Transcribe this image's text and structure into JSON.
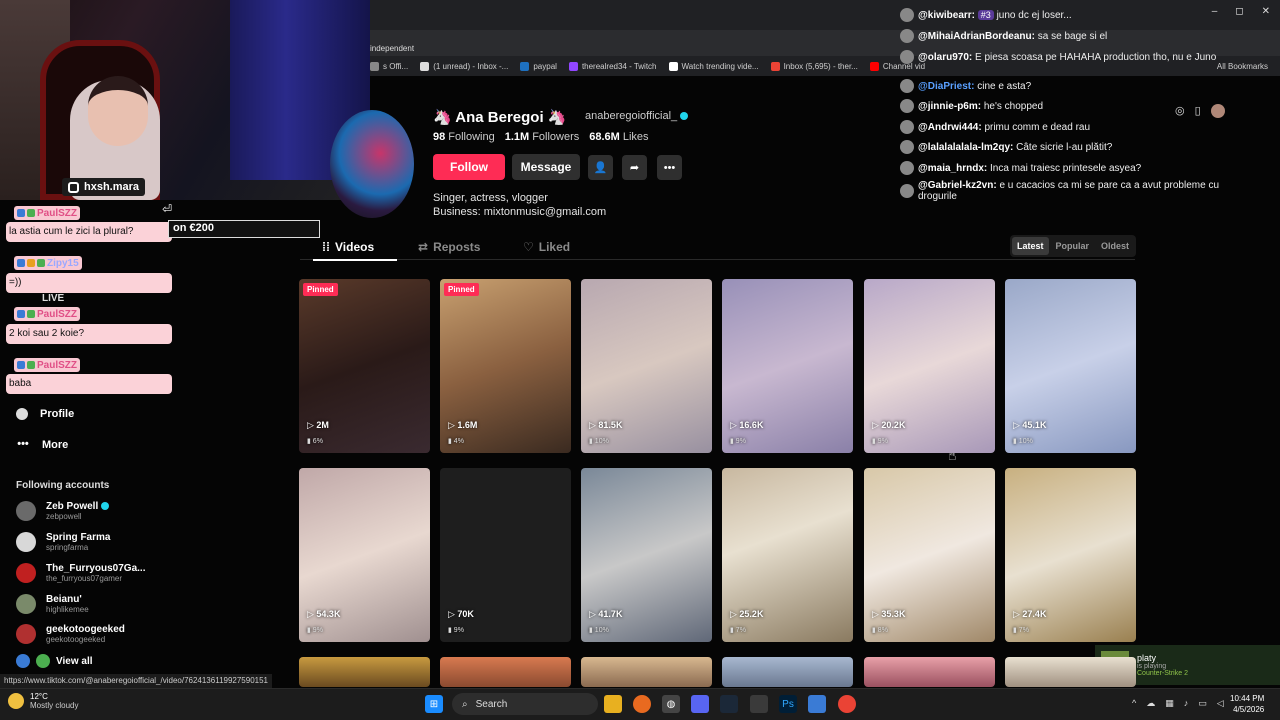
{
  "window": {
    "min": "–",
    "max": "◻",
    "close": "✕"
  },
  "bookmarks": [
    {
      "label": "s Offi...",
      "color": "#888"
    },
    {
      "label": "(1 unread) - Inbox -...",
      "color": "#ddd"
    },
    {
      "label": "paypal",
      "color": "#1e70bf"
    },
    {
      "label": "therealred34 - Twitch",
      "color": "#9146ff"
    },
    {
      "label": "Watch trending vide...",
      "color": "#fff"
    },
    {
      "label": "Inbox (5,695) - ther...",
      "color": "#ea4335"
    },
    {
      "label": "Channel vid",
      "color": "#ff0000"
    }
  ],
  "all_bookmarks": "All Bookmarks",
  "ig_handle": "hxsh.mara",
  "donation": "on €200",
  "left_chat": [
    {
      "user": "PaulSZZ",
      "msg": "la astia cum le zici la plural?"
    },
    {
      "user": "Zipy15",
      "msg": "=))"
    },
    {
      "user": "PaulSZZ",
      "msg": "2 koi sau 2 koie?"
    },
    {
      "user": "PaulSZZ",
      "msg": "baba"
    }
  ],
  "nav": {
    "profile": "Profile",
    "more": "More",
    "live": "LIVE"
  },
  "following_header": "Following accounts",
  "accounts": [
    {
      "name": "Zeb Powell",
      "handle": "zebpowell",
      "verified": true,
      "color": "#6a6a6a"
    },
    {
      "name": "Spring Farma",
      "handle": "springfarma",
      "verified": false,
      "color": "#d8d8d8"
    },
    {
      "name": "The_Furryous07Ga...",
      "handle": "the_furryous07gamer",
      "verified": false,
      "color": "#c02020"
    },
    {
      "name": "Beianu'",
      "handle": "highlikemee",
      "verified": false,
      "color": "#7a8a6a"
    },
    {
      "name": "geekotoogeeked",
      "handle": "geekotoogeeked",
      "verified": false,
      "color": "#b03030"
    }
  ],
  "view_all": "View all",
  "status_url": "https://www.tiktok.com/@anaberegoiofficial_/video/7624136119927590151",
  "profile": {
    "name": "🦄 Ana Beregoi 🦄",
    "username": "anaberegoiofficial_",
    "following": "98",
    "following_label": "Following",
    "followers": "1.1M",
    "followers_label": "Followers",
    "likes": "68.6M",
    "likes_label": "Likes",
    "follow": "Follow",
    "message": "Message",
    "bio1": "Singer, actress, vlogger",
    "bio2": "Business: mixtonmusic@gmail.com"
  },
  "tabs": {
    "videos": "Videos",
    "reposts": "Reposts",
    "liked": "Liked"
  },
  "sort": {
    "latest": "Latest",
    "popular": "Popular",
    "oldest": "Oldest"
  },
  "videos": [
    {
      "views": "2M",
      "pct": "6%",
      "pinned": "Pinned",
      "bg": "linear-gradient(160deg,#5a3a2a,#2a1a18 50%,#3a2a30)"
    },
    {
      "views": "1.6M",
      "pct": "4%",
      "pinned": "Pinned",
      "bg": "linear-gradient(160deg,#c8a070,#8a6040 50%,#3a2a20)"
    },
    {
      "views": "81.5K",
      "pct": "10%",
      "pinned": "",
      "bg": "linear-gradient(160deg,#b8a8b0,#d8c8c0 50%,#9890a0)"
    },
    {
      "views": "16.6K",
      "pct": "9%",
      "pinned": "",
      "bg": "linear-gradient(160deg,#9890b8,#c8b8d0 50%,#8a80a8)"
    },
    {
      "views": "20.2K",
      "pct": "9%",
      "pinned": "",
      "bg": "linear-gradient(160deg,#b8a8c8,#e8d8d8 50%,#a898b8)"
    },
    {
      "views": "45.1K",
      "pct": "10%",
      "pinned": "",
      "bg": "linear-gradient(160deg,#9aa8c8,#c8d0e8 50%,#8898c0)"
    },
    {
      "views": "54.3K",
      "pct": "9%",
      "pinned": "",
      "bg": "linear-gradient(160deg,#c0a8a8,#e8d8d0 50%,#a09090)"
    },
    {
      "views": "70K",
      "pct": "9%",
      "pinned": "",
      "bg": "#1e1e1e"
    },
    {
      "views": "41.7K",
      "pct": "10%",
      "pinned": "",
      "bg": "linear-gradient(160deg,#7a8898,#c8c8c8 50%,#606878)"
    },
    {
      "views": "25.2K",
      "pct": "7%",
      "pinned": "",
      "bg": "linear-gradient(160deg,#c8b8a0,#e8e0d0 40%,#8a7a60)"
    },
    {
      "views": "35.3K",
      "pct": "8%",
      "pinned": "",
      "bg": "linear-gradient(160deg,#d8c8a8,#f0e8e0 50%,#a08868)"
    },
    {
      "views": "27.4K",
      "pct": "7%",
      "pinned": "",
      "bg": "linear-gradient(160deg,#c8b080,#e8e0d0 50%,#9a8050)"
    },
    {
      "views": "",
      "pct": "",
      "pinned": "",
      "bg": "linear-gradient(#c89a40,#6a4a20)"
    },
    {
      "views": "",
      "pct": "",
      "pinned": "",
      "bg": "linear-gradient(#d87a50,#8a4a30)"
    },
    {
      "views": "",
      "pct": "",
      "pinned": "",
      "bg": "linear-gradient(#d8b890,#8a6a50)"
    },
    {
      "views": "",
      "pct": "",
      "pinned": "",
      "bg": "linear-gradient(#a8b8d0,#6a7890)"
    },
    {
      "views": "",
      "pct": "",
      "pinned": "",
      "bg": "linear-gradient(#e8a0a8,#9a5060)"
    },
    {
      "views": "",
      "pct": "",
      "pinned": "",
      "bg": "linear-gradient(#e8e0d0,#a09080)"
    }
  ],
  "right_chat": [
    {
      "user": "@kiwibearr:",
      "text": "juno dc ej loser...",
      "color": "#ffffff",
      "badge": "#3"
    },
    {
      "user": "@MihaiAdrianBordeanu:",
      "text": "sa se bage si el",
      "color": "#ffffff"
    },
    {
      "user": "@olaru970:",
      "text": "E piesa scoasa pe HAHAHA production tho, nu e Juno",
      "text2": "independent",
      "color": "#ffffff"
    },
    {
      "user": "@DiaPriest:",
      "text": "cine e asta?",
      "color": "#5aa0ff"
    },
    {
      "user": "@jinnie-p6m:",
      "text": "he's chopped",
      "color": "#ffffff"
    },
    {
      "user": "@Andrwi444:",
      "text": "primu comm e dead rau",
      "color": "#ffffff"
    },
    {
      "user": "@lalalalalala-lm2qy:",
      "text": "Câte sicrie l-au plătit?",
      "color": "#ffffff"
    },
    {
      "user": "@maia_hrndx:",
      "text": "Inca mai traiesc printesele asyea?",
      "color": "#ffffff"
    },
    {
      "user": "@Gabriel-kz2vn:",
      "text": "e u cacacios ca mi se pare ca a avut probleme cu",
      "text2": "drogurile",
      "color": "#ffffff"
    }
  ],
  "steam": {
    "user": "platy",
    "status": "is playing",
    "game": "Counter-Strike 2"
  },
  "weather": {
    "temp": "12°C",
    "desc": "Mostly cloudy"
  },
  "search_label": "Search",
  "clock": {
    "time": "10:44 PM",
    "date": "4/5/2026"
  }
}
